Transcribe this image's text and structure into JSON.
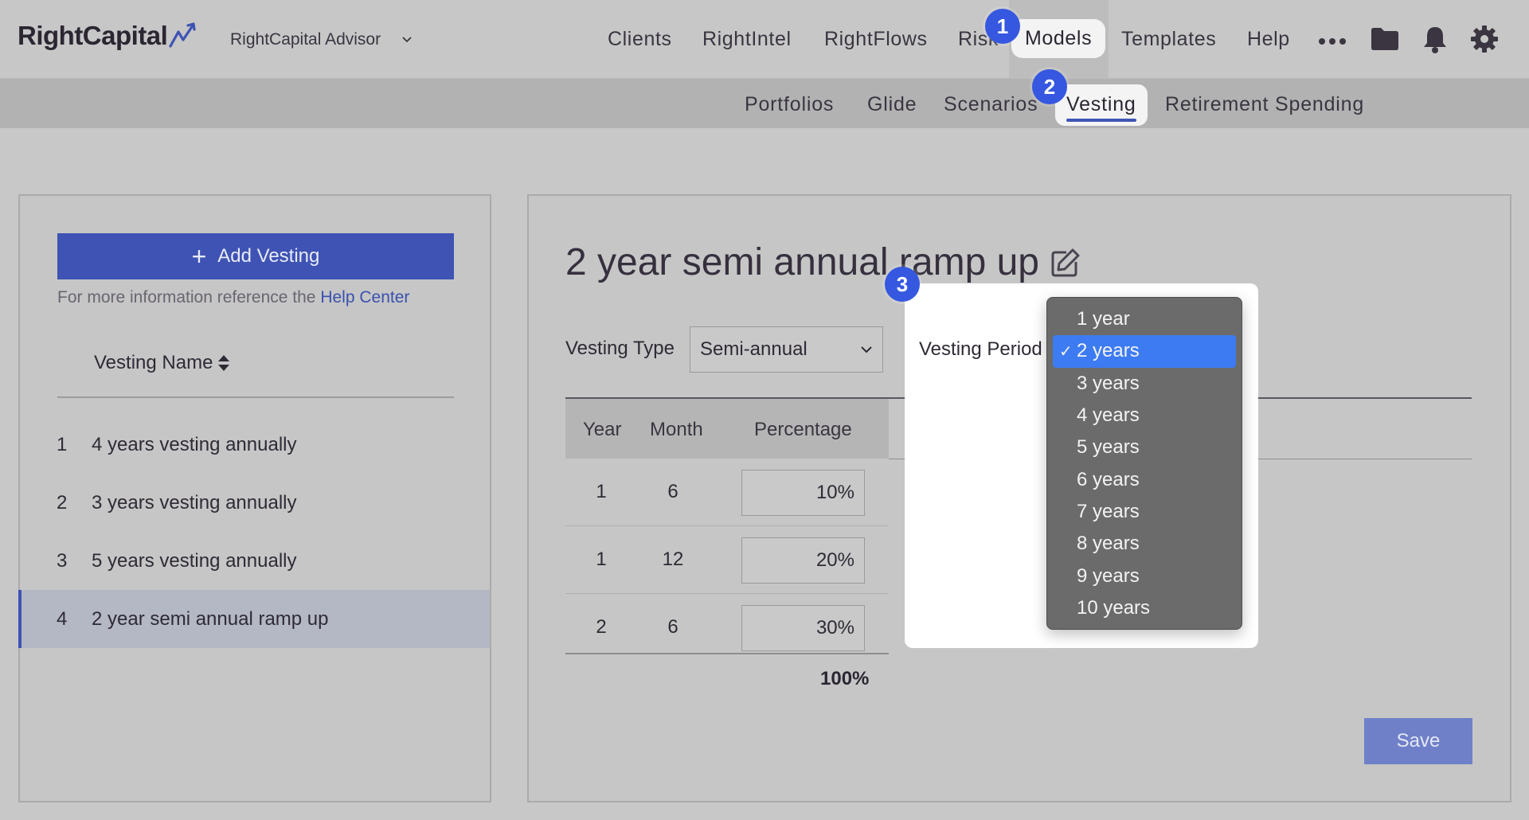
{
  "header": {
    "brand": "RightCapital",
    "advisor": "RightCapital Advisor",
    "nav": [
      {
        "label": "Clients"
      },
      {
        "label": "RightIntel"
      },
      {
        "label": "RightFlows"
      },
      {
        "label": "Risk"
      },
      {
        "label": "Models",
        "active": true
      },
      {
        "label": "Templates"
      },
      {
        "label": "Help"
      }
    ],
    "icons": [
      "more-icon",
      "folder-icon",
      "bell-icon",
      "gear-icon"
    ]
  },
  "subnav": [
    {
      "label": "Portfolios"
    },
    {
      "label": "Glide"
    },
    {
      "label": "Scenarios"
    },
    {
      "label": "Vesting",
      "active": true
    },
    {
      "label": "Retirement Spending"
    }
  ],
  "badges": [
    "1",
    "2",
    "3"
  ],
  "sidebar": {
    "add_label": "Add Vesting",
    "help_text": "For more information reference the",
    "help_link": "Help Center",
    "column_header": "Vesting Name",
    "items": [
      {
        "num": "1",
        "name": "4 years vesting annually"
      },
      {
        "num": "2",
        "name": "3 years vesting annually"
      },
      {
        "num": "3",
        "name": "5 years vesting annually"
      },
      {
        "num": "4",
        "name": "2 year semi annual ramp up",
        "selected": true
      }
    ]
  },
  "detail": {
    "title": "2 year semi annual ramp up",
    "vesting_type_label": "Vesting Type",
    "vesting_type_value": "Semi-annual",
    "vesting_period_label": "Vesting Period",
    "table": {
      "headers": [
        "Year",
        "Month",
        "Percentage"
      ],
      "rows": [
        {
          "year": "1",
          "month": "6",
          "percentage": "10%"
        },
        {
          "year": "1",
          "month": "12",
          "percentage": "20%"
        },
        {
          "year": "2",
          "month": "6",
          "percentage": "30%"
        }
      ],
      "total": "100%"
    },
    "save_label": "Save"
  },
  "period_dropdown": {
    "options": [
      "1 year",
      "2 years",
      "3 years",
      "4 years",
      "5 years",
      "6 years",
      "7 years",
      "8 years",
      "9 years",
      "10 years"
    ],
    "selected": "2 years",
    "check": "✓"
  },
  "colors": {
    "accent": "#3e53b3",
    "badge": "#3658e0",
    "selected_option": "#3d7bf2"
  }
}
